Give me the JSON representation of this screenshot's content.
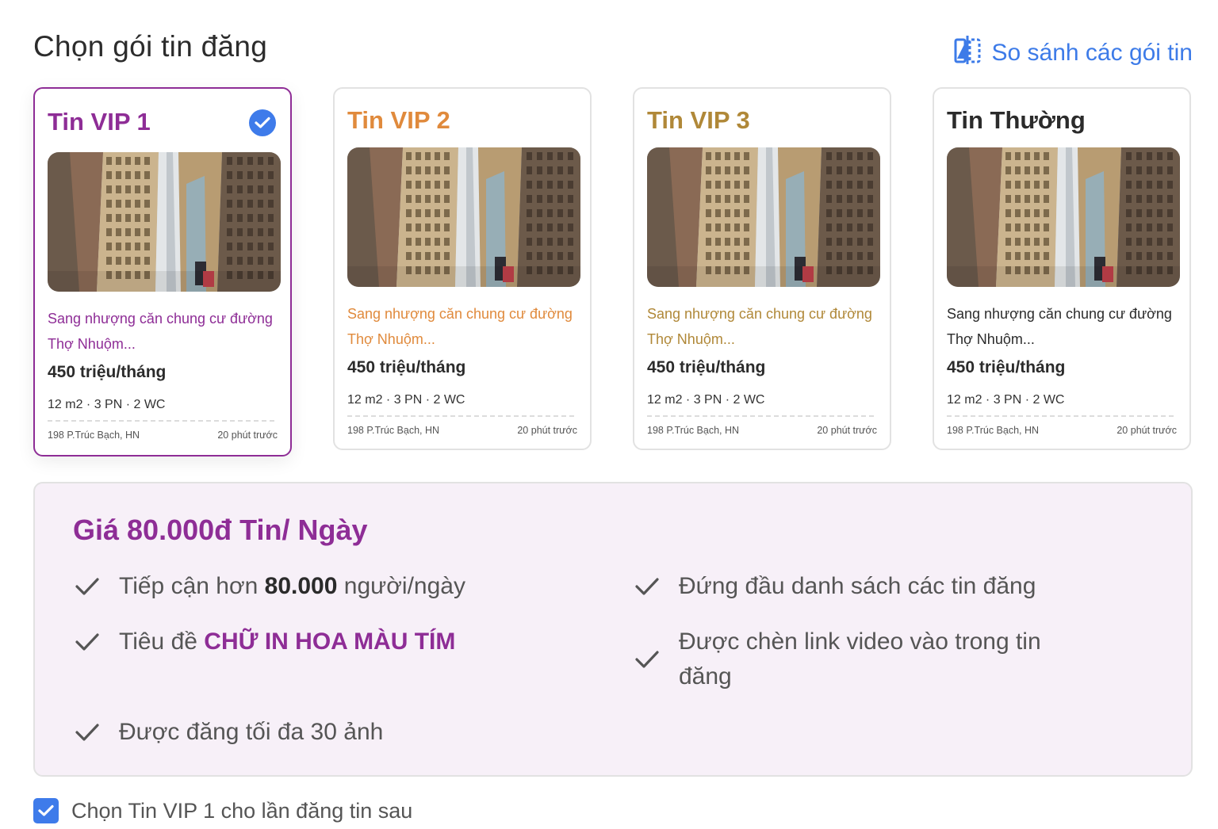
{
  "header": {
    "title": "Chọn gói tin đăng",
    "compare_label": "So sánh các gói tin",
    "compare_icon": "compare-icon"
  },
  "colors": {
    "vip1": "#8e2d96",
    "vip2": "#e08a3c",
    "vip3": "#b08838",
    "normal": "#2b2b2b",
    "accent": "#3e7bea",
    "benefit_bg": "#f7f0f8"
  },
  "packages": [
    {
      "name": "Tin VIP 1",
      "selected": true,
      "desc": "Sang nhượng căn chung cư đường Thợ Nhuộm...",
      "price": "450 triệu/tháng",
      "specs": "12 m2 · 3 PN · 2 WC",
      "address": "198 P.Trúc Bạch, HN",
      "time": "20 phút trước"
    },
    {
      "name": "Tin VIP 2",
      "selected": false,
      "desc": "Sang nhượng căn chung cư đường Thợ Nhuộm...",
      "price": "450 triệu/tháng",
      "specs": "12 m2 · 3 PN · 2 WC",
      "address": "198 P.Trúc Bạch, HN",
      "time": "20 phút trước"
    },
    {
      "name": "Tin VIP 3",
      "selected": false,
      "desc": "Sang nhượng căn chung cư đường Thợ Nhuộm...",
      "price": "450 triệu/tháng",
      "specs": "12 m2 · 3 PN · 2 WC",
      "address": "198 P.Trúc Bạch, HN",
      "time": "20 phút trước"
    },
    {
      "name": "Tin Thường",
      "selected": false,
      "desc": "Sang nhượng căn chung cư đường Thợ Nhuộm...",
      "price": "450 triệu/tháng",
      "specs": "12 m2 · 3 PN · 2 WC",
      "address": "198 P.Trúc Bạch, HN",
      "time": "20 phút trước"
    }
  ],
  "benefits": {
    "title": "Giá 80.000đ Tin/ Ngày",
    "reach_prefix": "Tiếp cận hơn",
    "reach_number": "80.000",
    "reach_suffix": "người/ngày",
    "top_list": "Đứng đầu danh sách các tin đăng",
    "title_prefix": "Tiêu đề",
    "title_highlight": "CHỮ IN HOA MÀU TÍM",
    "video_link": "Được chèn link video vào trong tin đăng",
    "max_photos": "Được đăng tối đa 30 ảnh"
  },
  "footer": {
    "checked": true,
    "label": "Chọn Tin VIP 1 cho lần đăng tin sau"
  }
}
